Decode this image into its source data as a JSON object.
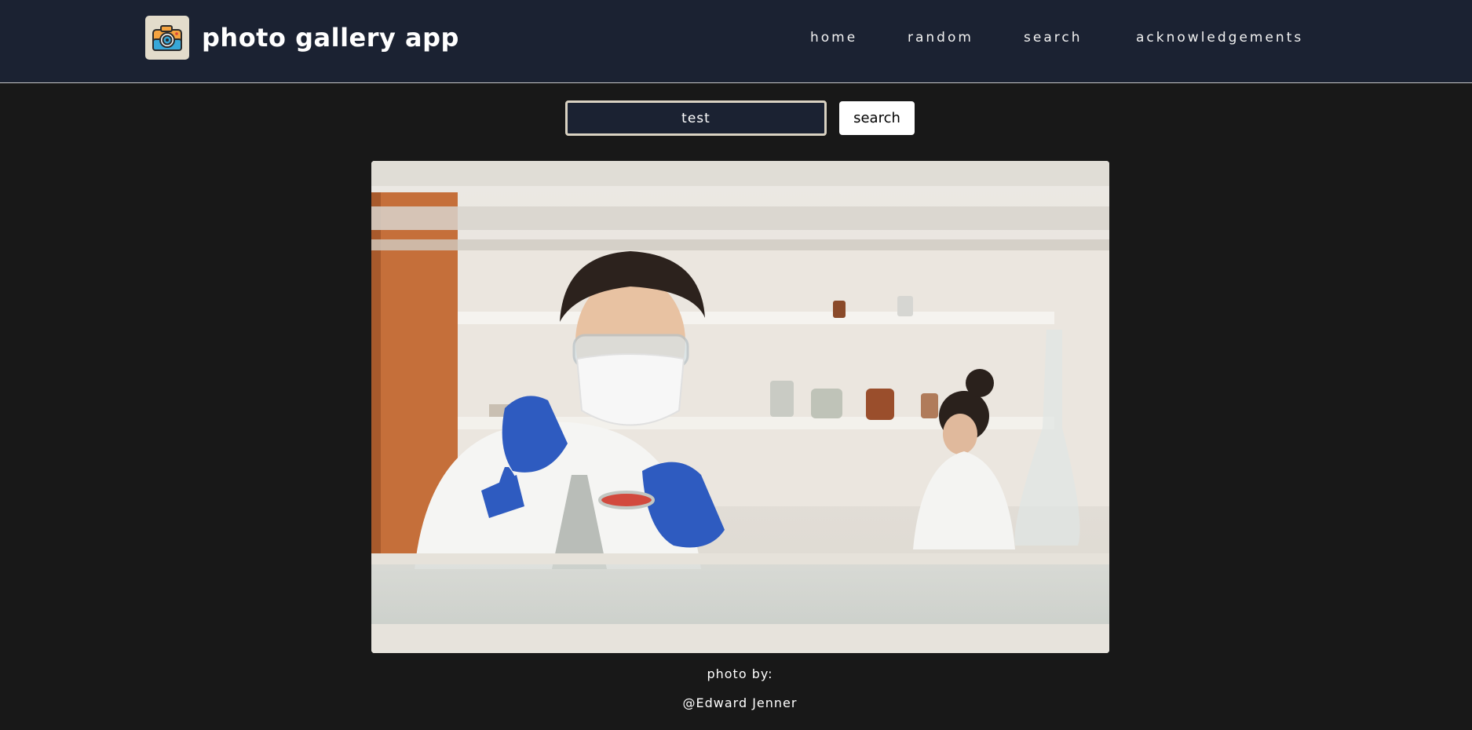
{
  "app": {
    "title": "photo gallery app",
    "icon": "camera-icon"
  },
  "nav": {
    "items": [
      {
        "label": "home"
      },
      {
        "label": "random"
      },
      {
        "label": "search"
      },
      {
        "label": "acknowledgements"
      }
    ]
  },
  "search": {
    "value": "test",
    "button_label": "search"
  },
  "photo": {
    "alt": "scientist in lab",
    "credit_label": "photo by:",
    "credit_name": "@Edward Jenner"
  },
  "colors": {
    "header_bg": "#1b2232",
    "page_bg": "#181818",
    "input_border": "#d9d2c2",
    "logo_bg": "#e3dccb"
  }
}
